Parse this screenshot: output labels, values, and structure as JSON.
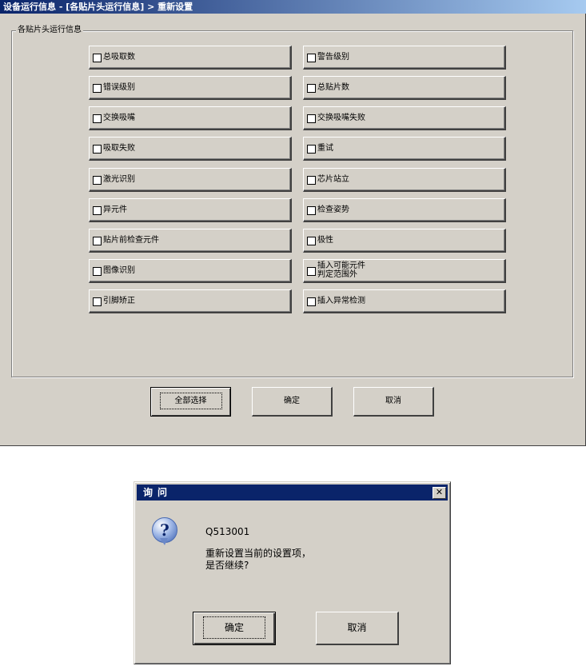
{
  "main_window": {
    "title": "设备运行信息 - [各贴片头运行信息] > 重新设置",
    "group_label": "各贴片头运行信息",
    "left_column": [
      "总吸取数",
      "错误级别",
      "交换吸嘴",
      "吸取失败",
      "激光识别",
      "异元件",
      "贴片前检查元件",
      "图像识别",
      "引脚矫正"
    ],
    "right_column": [
      "警告级别",
      "总贴片数",
      "交换吸嘴失败",
      "重试",
      "芯片站立",
      "检查姿势",
      "极性",
      "插入可能元件\n判定范围外",
      "插入异常检测"
    ],
    "buttons": {
      "select_all": "全部选择",
      "ok": "确定",
      "cancel": "取消"
    }
  },
  "dialog": {
    "title": "询问",
    "close_glyph": "✕",
    "icon": "question-icon",
    "code": "Q513001",
    "message": "重新设置当前的设置项，\n是否继续?",
    "buttons": {
      "ok": "确定",
      "cancel": "取消"
    }
  },
  "colors": {
    "face": "#d4d0c8",
    "title_active": "#0a246a",
    "title_gradient_end": "#a6caf0"
  }
}
